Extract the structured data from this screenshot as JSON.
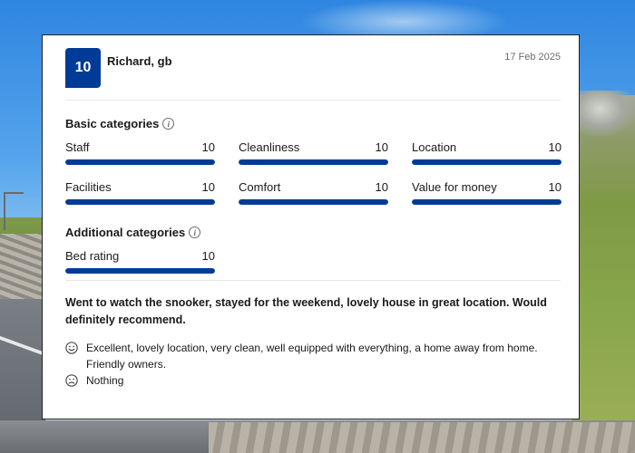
{
  "review": {
    "score": "10",
    "reviewer": "Richard, gb",
    "date": "17 Feb 2025",
    "basic_title": "Basic categories",
    "additional_title": "Additional categories",
    "info_icon": "i",
    "basic_categories": [
      {
        "label": "Staff",
        "score": "10",
        "fraction": 1.0
      },
      {
        "label": "Cleanliness",
        "score": "10",
        "fraction": 1.0
      },
      {
        "label": "Location",
        "score": "10",
        "fraction": 1.0
      },
      {
        "label": "Facilities",
        "score": "10",
        "fraction": 1.0
      },
      {
        "label": "Comfort",
        "score": "10",
        "fraction": 1.0
      },
      {
        "label": "Value for money",
        "score": "10",
        "fraction": 1.0
      }
    ],
    "additional_categories": [
      {
        "label": "Bed rating",
        "score": "10",
        "fraction": 1.0
      }
    ],
    "headline": "Went to watch the snooker, stayed for the weekend, lovely house in great location. Would definitely recommend.",
    "positive": "Excellent, lovely location, very clean, well equipped with everything, a home away from home. Friendly owners.",
    "negative": "Nothing"
  },
  "icons": {
    "info": "info-circle-icon",
    "positive": "smiley-face-icon",
    "negative": "sad-face-icon"
  },
  "colors": {
    "accent": "#003b95",
    "bar_track": "#e7e7e7"
  }
}
